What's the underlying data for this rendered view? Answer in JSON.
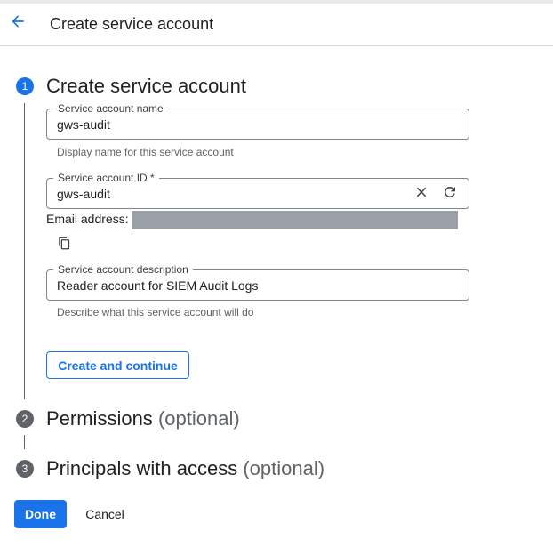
{
  "header": {
    "back_icon": "arrow-back-icon",
    "title": "Create service account"
  },
  "steps": [
    {
      "number": "1",
      "title": "Create service account",
      "optional": ""
    },
    {
      "number": "2",
      "title": "Permissions",
      "optional": "(optional)"
    },
    {
      "number": "3",
      "title": "Principals with access",
      "optional": "(optional)"
    }
  ],
  "form": {
    "name": {
      "label": "Service account name",
      "value": "gws-audit",
      "helper": "Display name for this service account"
    },
    "id": {
      "label": "Service account ID *",
      "value": "gws-audit",
      "clear_icon": "close-icon",
      "refresh_icon": "refresh-icon"
    },
    "email": {
      "label": "Email address:",
      "value_redacted": true,
      "copy_icon": "copy-icon"
    },
    "description": {
      "label": "Service account description",
      "value": "Reader account for SIEM Audit Logs",
      "helper": "Describe what this service account will do"
    },
    "continue_label": "Create and continue"
  },
  "footer": {
    "done_label": "Done",
    "cancel_label": "Cancel"
  },
  "colors": {
    "accent": "#1a73e8",
    "inactive_step": "#5f6368",
    "redaction": "#9aa0a6"
  }
}
